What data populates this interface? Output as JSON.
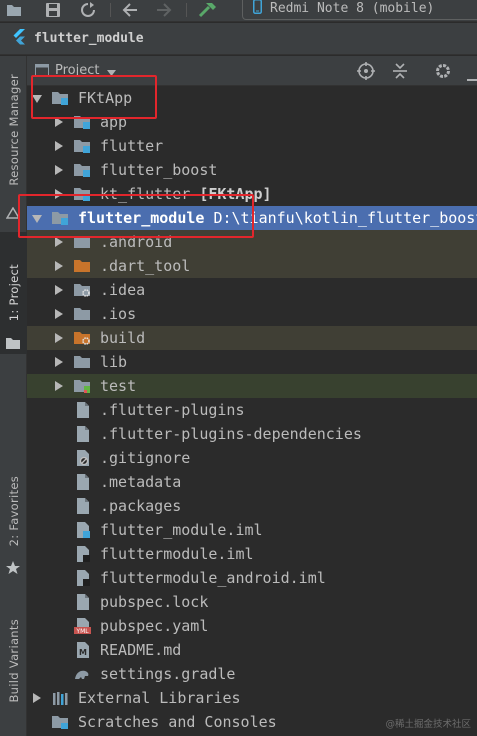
{
  "toolbar": {
    "device": "Redmi Note 8 (mobile)"
  },
  "breadcrumb": {
    "module": "flutter_module"
  },
  "side_tabs": {
    "resource_manager": "Resource Manager",
    "project": "1: Project",
    "favorites": "2: Favorites",
    "build_variants": "Build Variants"
  },
  "panel": {
    "title": "Project"
  },
  "tree": [
    {
      "label": "FKtApp",
      "extra": "",
      "level": 0,
      "arrow": "down",
      "icon": "module-folder",
      "style": ""
    },
    {
      "label": "app",
      "extra": "",
      "level": 1,
      "arrow": "right",
      "icon": "module-folder",
      "style": ""
    },
    {
      "label": "flutter",
      "extra": "",
      "level": 1,
      "arrow": "right",
      "icon": "module-folder",
      "style": ""
    },
    {
      "label": "flutter_boost",
      "extra": "",
      "level": 1,
      "arrow": "right",
      "icon": "module-folder",
      "style": ""
    },
    {
      "label": "kt_flutter",
      "extra": "[FKtApp]",
      "level": 1,
      "arrow": "right",
      "icon": "module-folder",
      "style": ""
    },
    {
      "label": "flutter_module",
      "extra": "D:\\tianfu\\kotlin_flutter_boost",
      "level": 0,
      "arrow": "down",
      "icon": "module-folder",
      "style": "sel"
    },
    {
      "label": ".android",
      "extra": "",
      "level": 1,
      "arrow": "right",
      "icon": "folder",
      "style": "excl"
    },
    {
      "label": ".dart_tool",
      "extra": "",
      "level": 1,
      "arrow": "right",
      "icon": "folder-orange",
      "style": "excl"
    },
    {
      "label": ".idea",
      "extra": "",
      "level": 1,
      "arrow": "right",
      "icon": "folder-gear",
      "style": ""
    },
    {
      "label": ".ios",
      "extra": "",
      "level": 1,
      "arrow": "right",
      "icon": "folder",
      "style": ""
    },
    {
      "label": "build",
      "extra": "",
      "level": 1,
      "arrow": "right",
      "icon": "folder-orange-gear",
      "style": "excl"
    },
    {
      "label": "lib",
      "extra": "",
      "level": 1,
      "arrow": "right",
      "icon": "folder",
      "style": ""
    },
    {
      "label": "test",
      "extra": "",
      "level": 1,
      "arrow": "right",
      "icon": "folder-test",
      "style": "test"
    },
    {
      "label": ".flutter-plugins",
      "extra": "",
      "level": 1,
      "arrow": "",
      "icon": "file",
      "style": ""
    },
    {
      "label": ".flutter-plugins-dependencies",
      "extra": "",
      "level": 1,
      "arrow": "",
      "icon": "file",
      "style": ""
    },
    {
      "label": ".gitignore",
      "extra": "",
      "level": 1,
      "arrow": "",
      "icon": "file-ignore",
      "style": ""
    },
    {
      "label": ".metadata",
      "extra": "",
      "level": 1,
      "arrow": "",
      "icon": "file",
      "style": ""
    },
    {
      "label": ".packages",
      "extra": "",
      "level": 1,
      "arrow": "",
      "icon": "file",
      "style": ""
    },
    {
      "label": "flutter_module.iml",
      "extra": "",
      "level": 1,
      "arrow": "",
      "icon": "file-iml-blue",
      "style": ""
    },
    {
      "label": "fluttermodule.iml",
      "extra": "",
      "level": 1,
      "arrow": "",
      "icon": "file-iml",
      "style": ""
    },
    {
      "label": "fluttermodule_android.iml",
      "extra": "",
      "level": 1,
      "arrow": "",
      "icon": "file-iml",
      "style": ""
    },
    {
      "label": "pubspec.lock",
      "extra": "",
      "level": 1,
      "arrow": "",
      "icon": "file",
      "style": ""
    },
    {
      "label": "pubspec.yaml",
      "extra": "",
      "level": 1,
      "arrow": "",
      "icon": "file-yaml",
      "style": ""
    },
    {
      "label": "README.md",
      "extra": "",
      "level": 1,
      "arrow": "",
      "icon": "file-md",
      "style": ""
    },
    {
      "label": "settings.gradle",
      "extra": "",
      "level": 1,
      "arrow": "",
      "icon": "gradle",
      "style": ""
    },
    {
      "label": "External Libraries",
      "extra": "",
      "level": 0,
      "arrow": "right",
      "icon": "libraries",
      "style": ""
    },
    {
      "label": "Scratches and Consoles",
      "extra": "",
      "level": 0,
      "arrow": "",
      "icon": "scratches",
      "style": ""
    }
  ],
  "icons": {
    "bar_colors": {
      "folder": "#8d9aa5",
      "orange": "#c8742b",
      "blue": "#40a4d8",
      "green": "#62b543",
      "selection": "#4b6eaf"
    }
  },
  "watermark": "@稀土掘金技术社区"
}
